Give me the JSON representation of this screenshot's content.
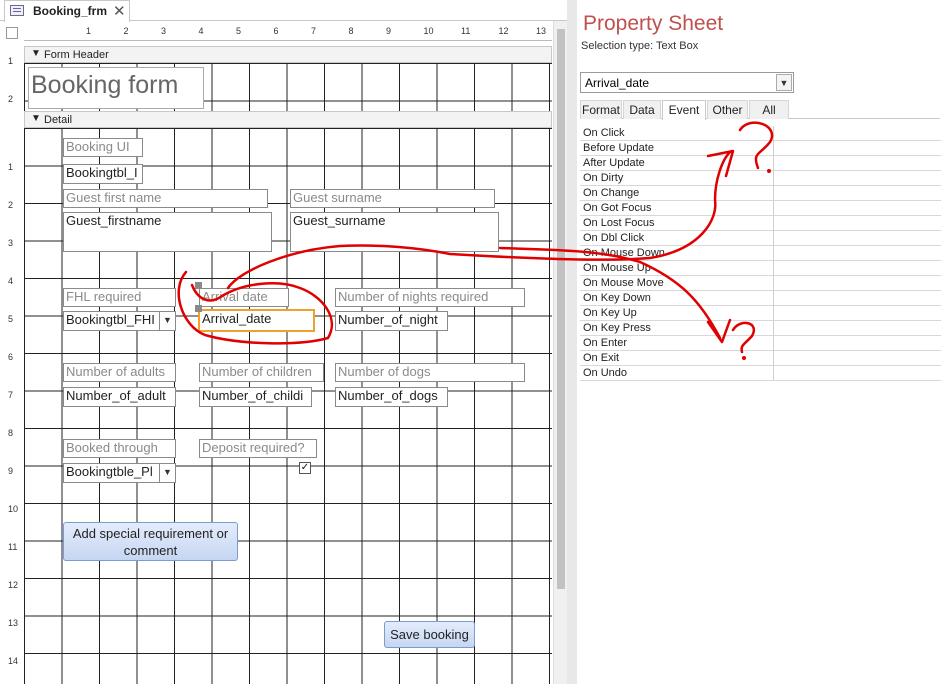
{
  "tab": {
    "title": "Booking_frm",
    "close": "✕"
  },
  "ruler": {
    "top": [
      "1",
      "2",
      "3",
      "4",
      "5",
      "6",
      "7",
      "8",
      "9",
      "10",
      "11",
      "12",
      "13"
    ],
    "left": [
      "1",
      "2",
      "1",
      "2",
      "3",
      "4",
      "5",
      "6",
      "7",
      "8",
      "9",
      "10",
      "11",
      "12",
      "13",
      "14"
    ]
  },
  "sections": {
    "header": "Form Header",
    "detail": "Detail"
  },
  "form": {
    "title": "Booking form",
    "booking_ui_label": "Booking UI",
    "bookingtbl_text": "Bookingtbl_I",
    "guest_first_label": "Guest first name",
    "guest_surname_label": "Guest surname",
    "guest_firstname_text": "Guest_firstname",
    "guest_surname_text": "Guest_surname",
    "fhl_label": "FHL required",
    "arrival_label": "Arrival date",
    "nights_label": "Number of nights required",
    "fhl_combo": "Bookingtbl_FHI",
    "arrival_text": "Arrival_date",
    "nights_text": "Number_of_night",
    "adults_label": "Number of adults",
    "children_label": "Number of children",
    "dogs_label": "Number of dogs",
    "adults_text": "Number_of_adult",
    "children_text": "Number_of_childi",
    "dogs_text": "Number_of_dogs",
    "booked_label": "Booked through",
    "deposit_label": "Deposit required?",
    "booked_combo": "Bookingtble_Pl",
    "deposit_checked": "✓",
    "special_button": "Add special requirement or comment",
    "save_button": "Save booking"
  },
  "property_sheet": {
    "title": "Property Sheet",
    "selection_type": "Selection type:  Text Box",
    "selected_object": "Arrival_date",
    "tabs": [
      "Format",
      "Data",
      "Event",
      "Other",
      "All"
    ],
    "active_tab": "Event",
    "events": [
      "On Click",
      "Before Update",
      "After Update",
      "On Dirty",
      "On Change",
      "On Got Focus",
      "On Lost Focus",
      "On Dbl Click",
      "On Mouse Down",
      "On Mouse Up",
      "On Mouse Move",
      "On Key Down",
      "On Key Up",
      "On Key Press",
      "On Enter",
      "On Exit",
      "On Undo"
    ]
  },
  "annotation": {
    "color": "#e00000",
    "mark_1": "?",
    "mark_2": "?"
  },
  "colors": {
    "accent_title": "#c0504d",
    "selection_border": "#f0a030",
    "button_fill": "#c6d6f2"
  }
}
